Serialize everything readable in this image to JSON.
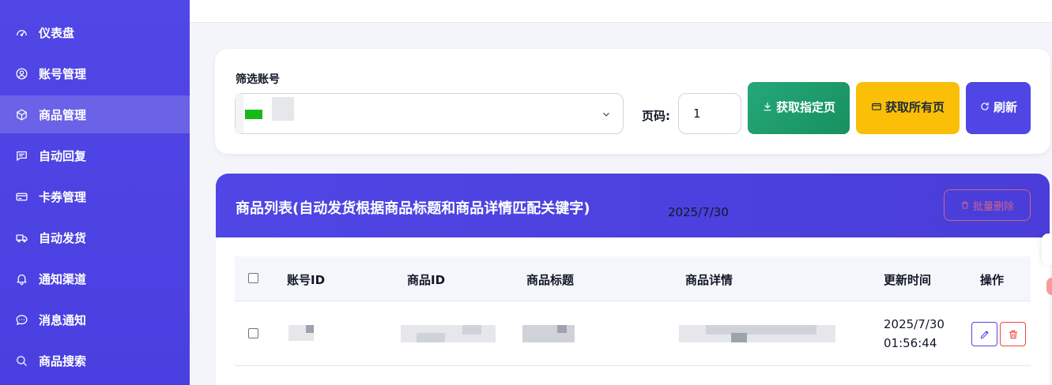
{
  "sidebar": {
    "items": [
      {
        "label": "仪表盘",
        "icon": "gauge-icon"
      },
      {
        "label": "账号管理",
        "icon": "user-circle-icon"
      },
      {
        "label": "商品管理",
        "icon": "box-icon",
        "active": true
      },
      {
        "label": "自动回复",
        "icon": "message-icon"
      },
      {
        "label": "卡券管理",
        "icon": "card-icon"
      },
      {
        "label": "自动发货",
        "icon": "truck-icon"
      },
      {
        "label": "通知渠道",
        "icon": "bell-icon"
      },
      {
        "label": "消息通知",
        "icon": "chat-icon"
      },
      {
        "label": "商品搜索",
        "icon": "search-icon"
      }
    ]
  },
  "filter": {
    "account_label": "筛选账号",
    "page_label": "页码:",
    "page_value": "1",
    "fetch_page_label": "获取指定页",
    "fetch_all_label": "获取所有页",
    "refresh_label": "刷新"
  },
  "product_list": {
    "title": "商品列表(自动发货根据商品标题和商品详情匹配关键字)",
    "bulk_delete_label": "批量删除",
    "columns": [
      "账号ID",
      "商品ID",
      "商品标题",
      "商品详情",
      "更新时间",
      "操作"
    ],
    "rows": [
      {
        "updated_date": "2025/7/30",
        "updated_time": "01:56:44"
      }
    ],
    "next_row_time_partial": "2025/7/30"
  },
  "colors": {
    "primary": "#4f46e5",
    "success": "#1f9e6c",
    "warning": "#fbbf07",
    "danger": "#ef4444"
  }
}
